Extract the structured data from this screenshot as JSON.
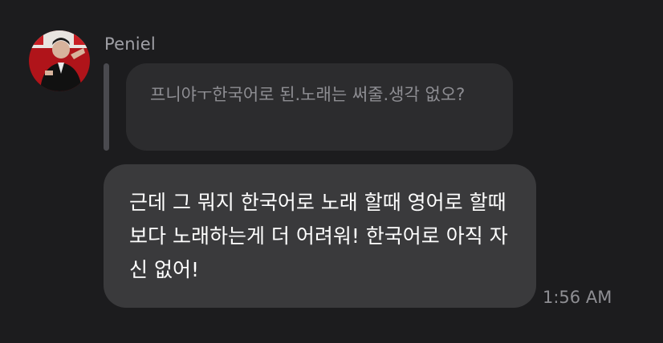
{
  "message": {
    "sender": "Peniel",
    "quoted_text": "프니야ㅜ한국어로 된.노래는 써줄.생각 없오?",
    "text": "근데 그 뭐지 한국어로 노래 할때 영어로 할때 보다 노래하는게 더 어려워! 한국어로 아직 자신 없어!",
    "time": "1:56 AM",
    "colors": {
      "background": "#1c1c1e",
      "quote_bubble": "#2c2c2e",
      "message_bubble": "#3a3a3c",
      "secondary_text": "#8e8e93"
    }
  }
}
